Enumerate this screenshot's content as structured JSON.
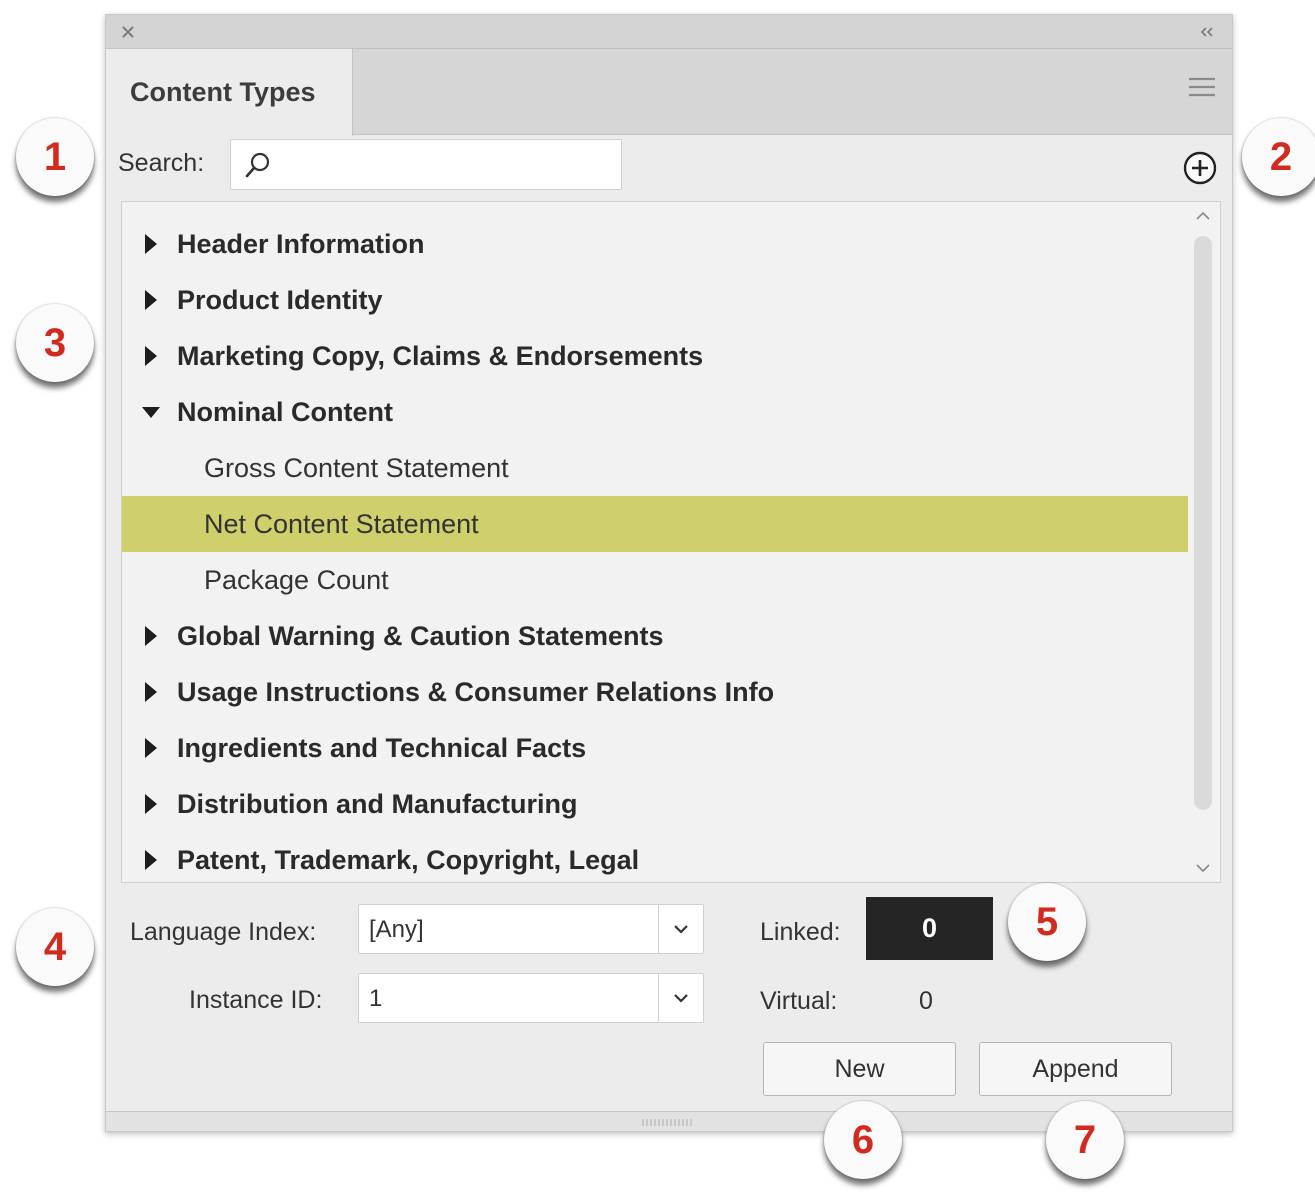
{
  "panel": {
    "tab_label": "Content Types",
    "search_label": "Search:",
    "search_value": "",
    "search_placeholder": ""
  },
  "tree": {
    "items": [
      {
        "label": "Header Information",
        "kind": "group",
        "expanded": false
      },
      {
        "label": "Product Identity",
        "kind": "group",
        "expanded": false
      },
      {
        "label": "Marketing Copy, Claims & Endorsements",
        "kind": "group",
        "expanded": false
      },
      {
        "label": "Nominal Content",
        "kind": "group",
        "expanded": true
      },
      {
        "label": "Gross Content Statement",
        "kind": "child"
      },
      {
        "label": "Net Content Statement",
        "kind": "child",
        "selected": true
      },
      {
        "label": "Package Count",
        "kind": "child"
      },
      {
        "label": "Global Warning & Caution Statements",
        "kind": "group",
        "expanded": false
      },
      {
        "label": "Usage Instructions & Consumer Relations Info",
        "kind": "group",
        "expanded": false
      },
      {
        "label": "Ingredients and Technical Facts",
        "kind": "group",
        "expanded": false
      },
      {
        "label": "Distribution and Manufacturing",
        "kind": "group",
        "expanded": false
      },
      {
        "label": "Patent, Trademark, Copyright, Legal",
        "kind": "group",
        "expanded": false
      }
    ]
  },
  "form": {
    "language_label": "Language Index:",
    "language_value": "[Any]",
    "instance_label": "Instance ID:",
    "instance_value": "1",
    "linked_label": "Linked:",
    "linked_value": "0",
    "virtual_label": "Virtual:",
    "virtual_value": "0"
  },
  "buttons": {
    "new_label": "New",
    "append_label": "Append"
  },
  "callouts": [
    "1",
    "2",
    "3",
    "4",
    "5",
    "6",
    "7"
  ],
  "colors": {
    "selection": "#cfd06c",
    "callout_number": "#d22a1f",
    "linked_box": "#252525"
  }
}
